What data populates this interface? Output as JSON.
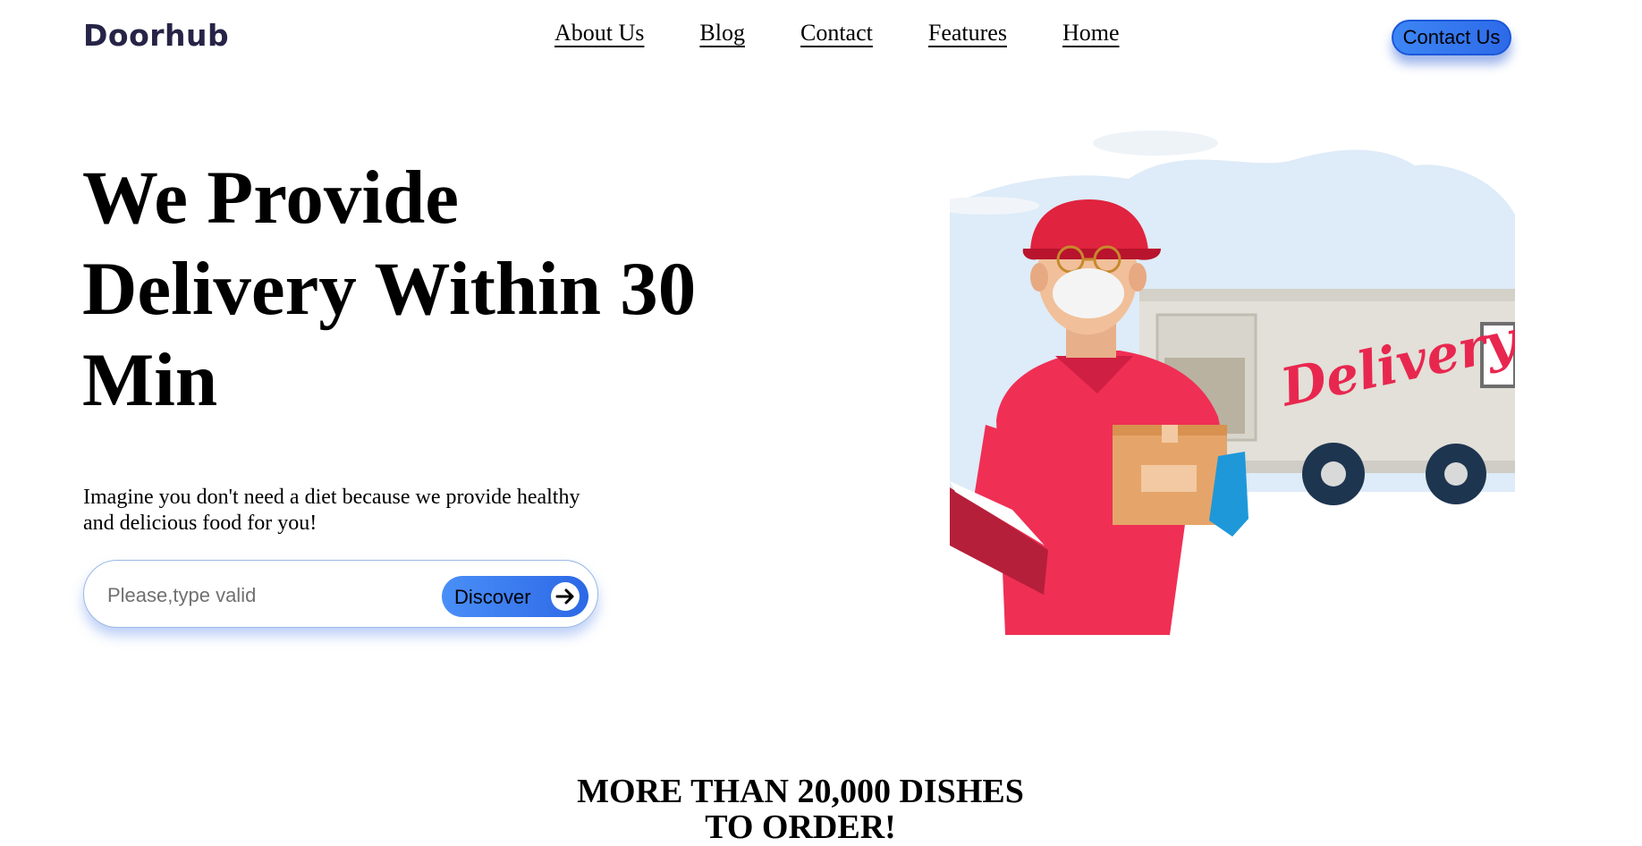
{
  "header": {
    "logo": "Doorhub",
    "nav": [
      "About Us",
      "Blog",
      "Contact",
      "Features",
      "Home"
    ],
    "cta_label": "Contact Us"
  },
  "hero": {
    "title": "We Provide Delivery Within 30 Min",
    "subtitle": "Imagine you don't need a diet because we provide healthy and delicious food for you!",
    "search": {
      "placeholder": "Please,type valid",
      "value": ""
    },
    "discover_label": "Discover",
    "illustration_text": "Delivery!"
  },
  "section": {
    "heading": "MORE THAN 20,000 DISHES TO ORDER!"
  },
  "colors": {
    "brand": "#262446",
    "accent": "#2d6ae8",
    "shirt": "#f02f55",
    "box": "#e5a56a"
  },
  "icons": {
    "discover_arrow": "arrow-right-icon"
  }
}
